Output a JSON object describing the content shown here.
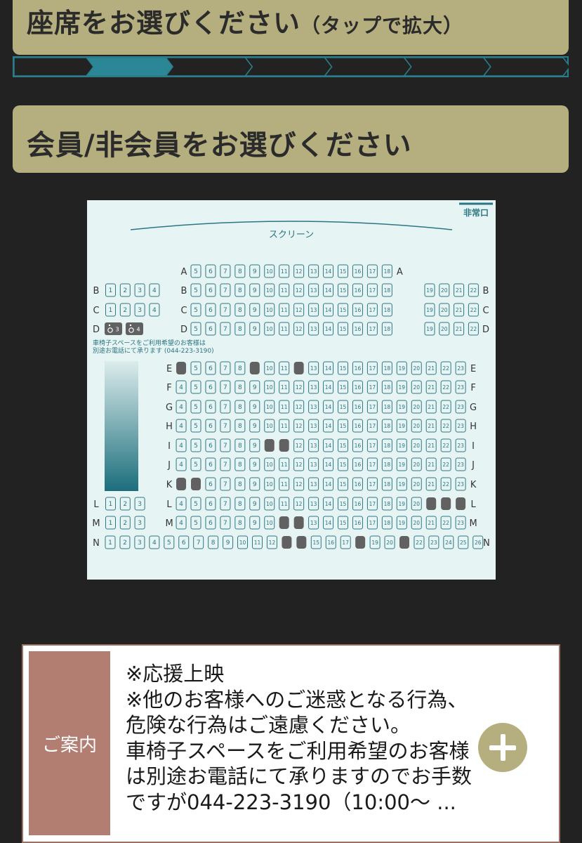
{
  "header": {
    "title": "座席をお選びください",
    "hint": "（タップで拡大）"
  },
  "progress": {
    "total_steps": 7,
    "current_step": 2
  },
  "member_section": {
    "title": "会員/非会員をお選びください"
  },
  "seat_map": {
    "emergency_exit": "非常口",
    "screen_label": "スクリーン",
    "wheelchair_note_line1": "車椅子スペースをご利用希望のお客様は",
    "wheelchair_note_line2": "別途お電話にて承ります (044-223-3190)",
    "wheelchair_seats": [
      "3",
      "4"
    ],
    "colors": {
      "available": "#2c7683",
      "occupied": "#616161",
      "background": "#e7f4f4"
    },
    "rows": [
      {
        "row": "A",
        "left": [],
        "center": [
          5,
          6,
          7,
          8,
          9,
          10,
          11,
          12,
          13,
          14,
          15,
          16,
          17,
          18
        ],
        "right": [],
        "occupied": []
      },
      {
        "row": "B",
        "left": [
          1,
          2,
          3,
          4
        ],
        "center": [
          5,
          6,
          7,
          8,
          9,
          10,
          11,
          12,
          13,
          14,
          15,
          16,
          17,
          18
        ],
        "right": [
          19,
          20,
          21,
          22
        ],
        "occupied": []
      },
      {
        "row": "C",
        "left": [
          1,
          2,
          3,
          4
        ],
        "center": [
          5,
          6,
          7,
          8,
          9,
          10,
          11,
          12,
          13,
          14,
          15,
          16,
          17,
          18
        ],
        "right": [
          19,
          20,
          21,
          22
        ],
        "occupied": []
      },
      {
        "row": "D",
        "left": [
          3,
          4
        ],
        "center": [
          5,
          6,
          7,
          8,
          9,
          10,
          11,
          12,
          13,
          14,
          15,
          16,
          17,
          18
        ],
        "right": [
          19,
          20,
          21,
          22
        ],
        "occupied": []
      },
      {
        "row": "E",
        "left": [],
        "center": [
          4,
          5,
          6,
          7,
          8,
          9,
          10,
          11,
          12,
          13,
          14,
          15,
          16,
          17,
          18,
          19,
          20,
          21,
          22,
          23
        ],
        "right": [],
        "occupied": [
          4,
          9,
          12
        ]
      },
      {
        "row": "F",
        "left": [],
        "center": [
          4,
          5,
          6,
          7,
          8,
          9,
          10,
          11,
          12,
          13,
          14,
          15,
          16,
          17,
          18,
          19,
          20,
          21,
          22,
          23
        ],
        "right": [],
        "occupied": []
      },
      {
        "row": "G",
        "left": [],
        "center": [
          4,
          5,
          6,
          7,
          8,
          9,
          10,
          11,
          12,
          13,
          14,
          15,
          16,
          17,
          18,
          19,
          20,
          21,
          22,
          23
        ],
        "right": [],
        "occupied": []
      },
      {
        "row": "H",
        "left": [],
        "center": [
          4,
          5,
          6,
          7,
          8,
          9,
          10,
          11,
          12,
          13,
          14,
          15,
          16,
          17,
          18,
          19,
          20,
          21,
          22,
          23
        ],
        "right": [],
        "occupied": []
      },
      {
        "row": "I",
        "left": [],
        "center": [
          4,
          5,
          6,
          7,
          8,
          9,
          10,
          11,
          12,
          13,
          14,
          15,
          16,
          17,
          18,
          19,
          20,
          21,
          22,
          23
        ],
        "right": [],
        "occupied": [
          10,
          11
        ]
      },
      {
        "row": "J",
        "left": [],
        "center": [
          4,
          5,
          6,
          7,
          8,
          9,
          10,
          11,
          12,
          13,
          14,
          15,
          16,
          17,
          18,
          19,
          20,
          21,
          22,
          23
        ],
        "right": [],
        "occupied": []
      },
      {
        "row": "K",
        "left": [],
        "center": [
          4,
          5,
          6,
          7,
          8,
          9,
          10,
          11,
          12,
          13,
          14,
          15,
          16,
          17,
          18,
          19,
          20,
          21,
          22,
          23
        ],
        "right": [],
        "occupied": [
          4,
          5
        ]
      },
      {
        "row": "L",
        "left": [
          1,
          2,
          3
        ],
        "center": [
          4,
          5,
          6,
          7,
          8,
          9,
          10,
          11,
          12,
          13,
          14,
          15,
          16,
          17,
          18,
          19,
          20,
          21,
          22,
          23
        ],
        "right": [],
        "occupied": [
          21,
          22,
          23
        ]
      },
      {
        "row": "M",
        "left": [
          1,
          2,
          3
        ],
        "center": [
          4,
          5,
          6,
          7,
          8,
          9,
          10,
          11,
          12,
          13,
          14,
          15,
          16,
          17,
          18,
          19,
          20,
          21,
          22,
          23
        ],
        "right": [],
        "occupied": [
          11,
          12
        ]
      },
      {
        "row": "N",
        "left": [
          1,
          2,
          3,
          4,
          5,
          6,
          7,
          8,
          9,
          10,
          11,
          12,
          13,
          14,
          15,
          16,
          17,
          18,
          19,
          20,
          21,
          22,
          23,
          24,
          25,
          26
        ],
        "center": [],
        "right": [],
        "occupied": [
          13,
          14,
          18,
          21
        ]
      }
    ]
  },
  "info": {
    "label": "ご案内",
    "text": "※応援上映\n※他のお客様へのご迷惑となる行為、\n危険な行為はご遠慮ください。\n車椅子スペースをご利用希望のお客様\nは別途お電話にて承りますのでお手数\nですが044-223-3190（10:00〜 ...",
    "expand_icon": "plus-icon"
  }
}
